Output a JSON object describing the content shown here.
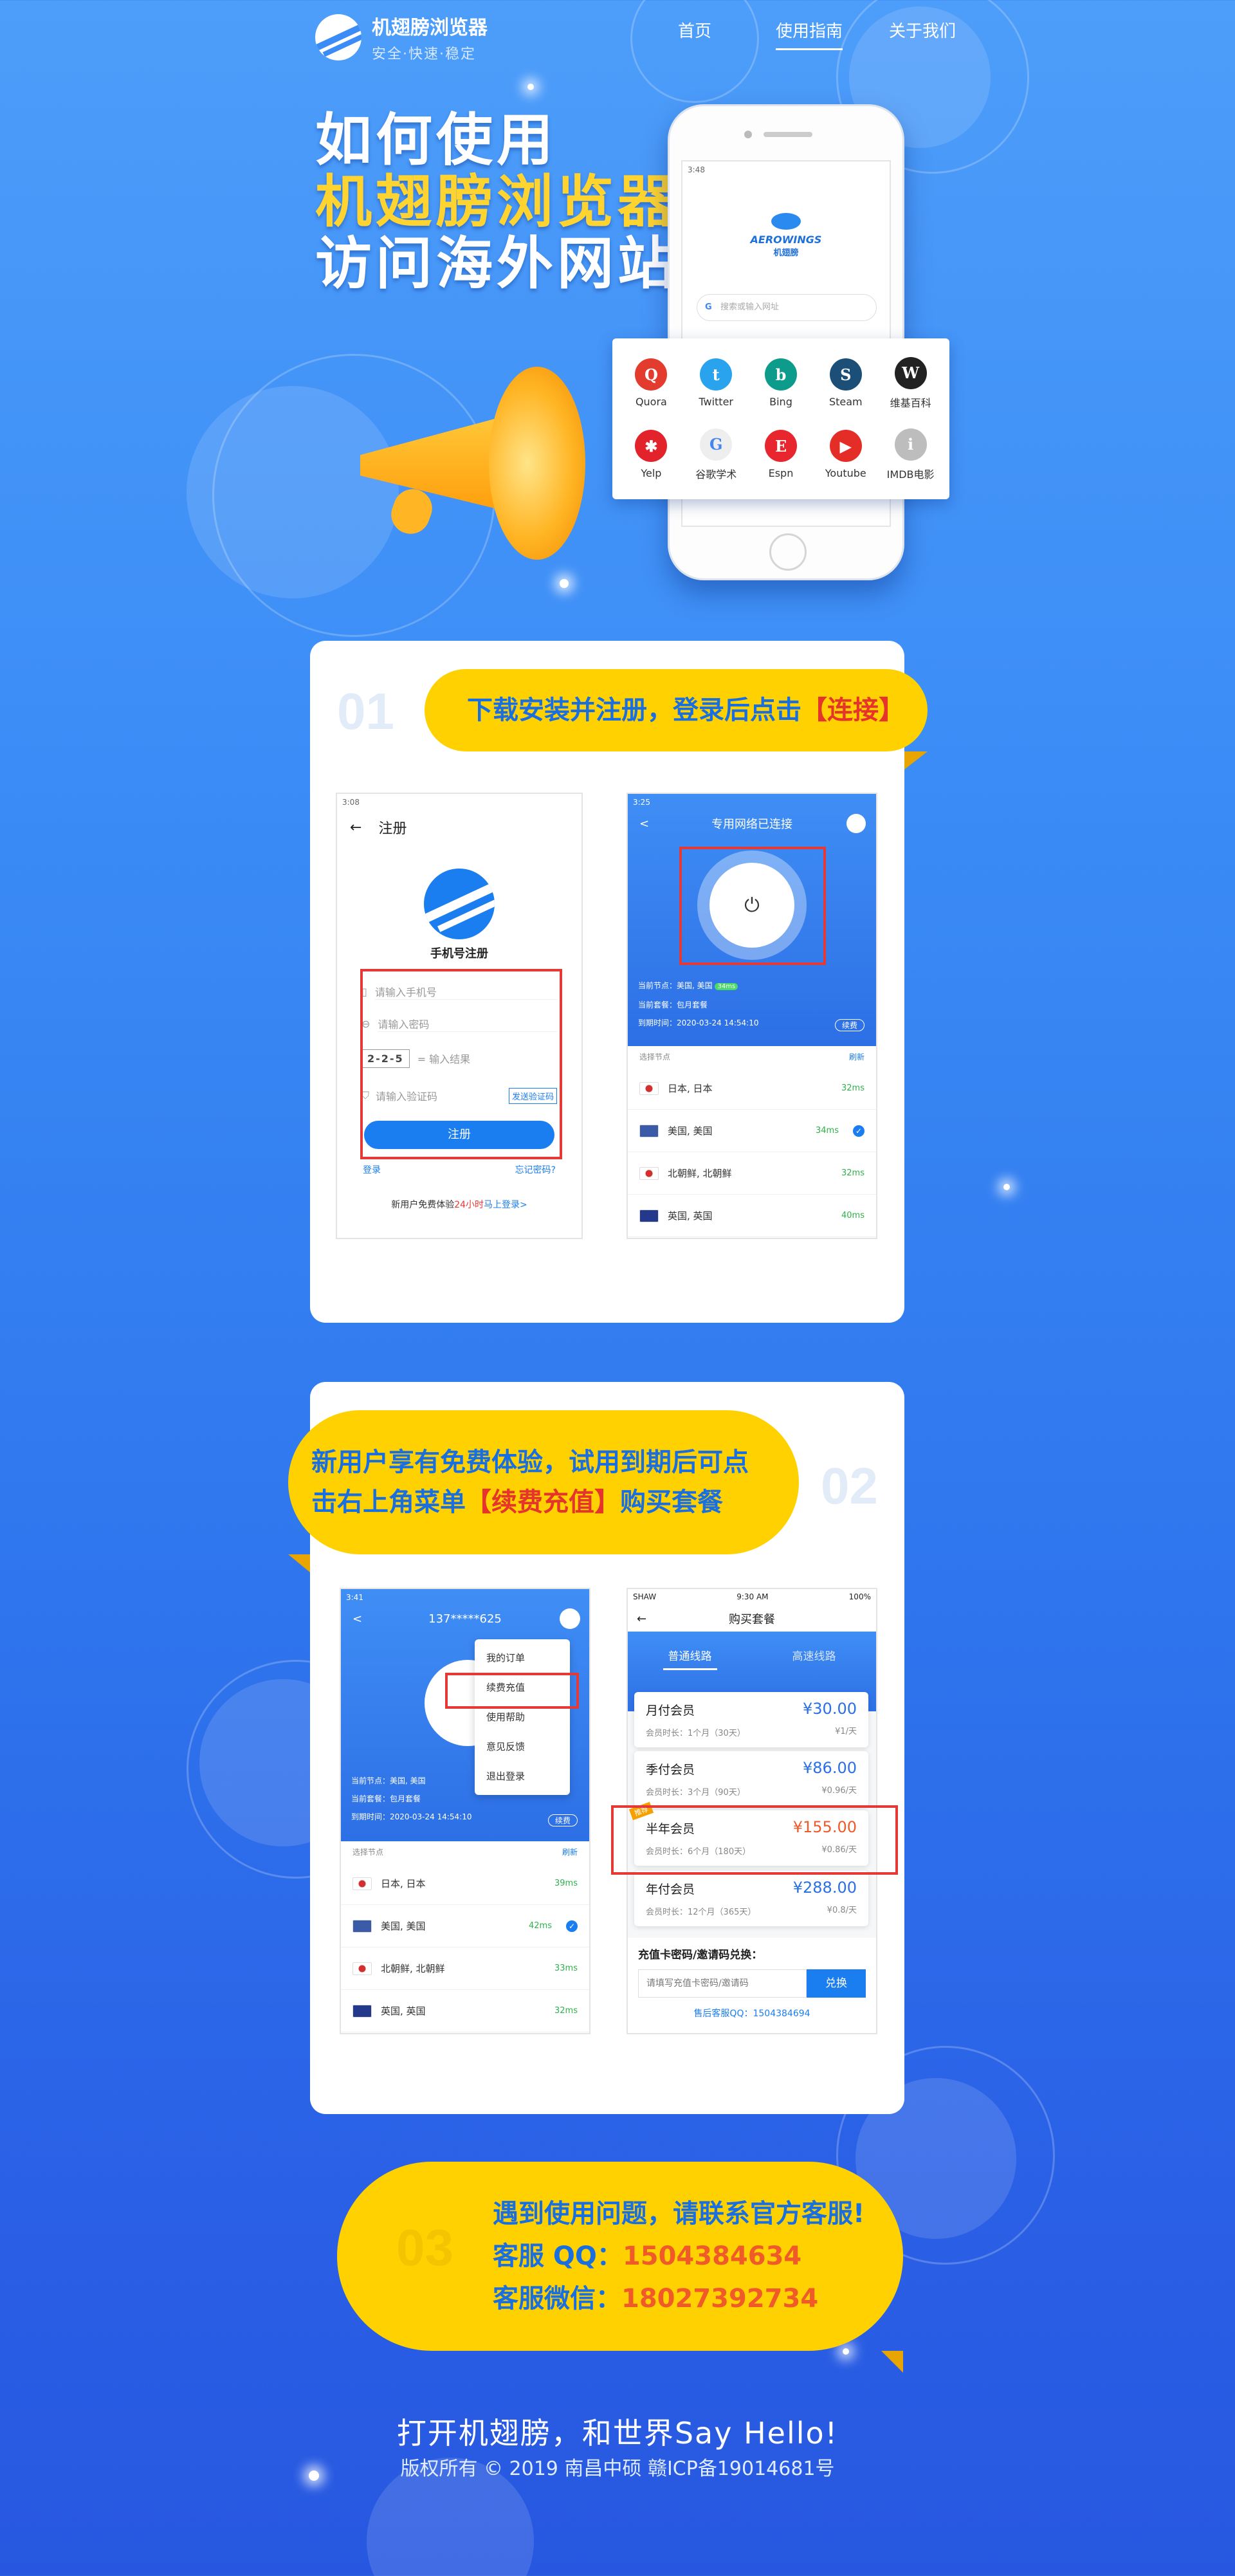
{
  "header": {
    "brand_name": "机翅膀浏览器",
    "brand_slogan": "安全·快速·稳定",
    "nav": [
      "首页",
      "使用指南",
      "关于我们"
    ],
    "active_nav": "使用指南"
  },
  "hero": {
    "line1": "如何使用",
    "line2": "机翅膀浏览器",
    "line3": "访问海外网站"
  },
  "phone_mock": {
    "status_time": "3:48",
    "logo_en": "AEROWINGS",
    "logo_cn": "机翅膀",
    "search_placeholder": "搜索或输入网址"
  },
  "sites": [
    {
      "label": "Quora",
      "glyph": "Q",
      "color": "#e33b2e"
    },
    {
      "label": "Twitter",
      "glyph": "t",
      "color": "#2aa3ef"
    },
    {
      "label": "Bing",
      "glyph": "b",
      "color": "#0d9b8b"
    },
    {
      "label": "Steam",
      "glyph": "S",
      "color": "#1b4f78"
    },
    {
      "label": "维基百科",
      "glyph": "W",
      "color": "#222222"
    },
    {
      "label": "Yelp",
      "glyph": "✱",
      "color": "#e3232b"
    },
    {
      "label": "谷歌学术",
      "glyph": "G",
      "color": "#eeeeee"
    },
    {
      "label": "Espn",
      "glyph": "E",
      "color": "#e8262e"
    },
    {
      "label": "Youtube",
      "glyph": "▶",
      "color": "#e52d27"
    },
    {
      "label": "IMDB电影",
      "glyph": "i",
      "color": "#bdbdbd"
    }
  ],
  "step1": {
    "num": "01",
    "title_pre": "下载安装并注册，登录后点击",
    "title_hl": "【连接】",
    "register": {
      "status_time": "3:08",
      "back": "←",
      "title": "注册",
      "subtitle": "手机号注册",
      "phone_ph": "请输入手机号",
      "password_ph": "请输入密码",
      "captcha_img": "2-2-5",
      "captcha_ph": "= 输入结果",
      "code_ph": "请输入验证码",
      "send_code": "发送验证码",
      "submit": "注册",
      "login": "登录",
      "forgot": "忘记密码?",
      "promo_pre": "新用户免费体验",
      "promo_hl": "24小时",
      "promo_link": "马上登录>"
    },
    "connect": {
      "status_time": "3:25",
      "title": "专用网络已连接",
      "node_label": "当前节点：",
      "node_value": "美国, 美国",
      "node_ms": "34ms",
      "pkg_label": "当前套餐：",
      "pkg_value": "包月套餐",
      "expire_label": "到期时间：",
      "expire_value": "2020-03-24 14:54:10",
      "renew": "续费",
      "list_title": "选择节点",
      "refresh": "刷新",
      "nodes": [
        {
          "name": "日本, 日本",
          "ms": "32ms",
          "color": "#ffffff"
        },
        {
          "name": "美国, 美国",
          "ms": "34ms",
          "color": "#3b5ba9"
        },
        {
          "name": "北朝鲜, 北朝鲜",
          "ms": "32ms",
          "color": "#ffffff"
        },
        {
          "name": "英国, 英国",
          "ms": "40ms",
          "color": "#233a8c"
        }
      ]
    }
  },
  "step2": {
    "num": "02",
    "line1": "新用户享有免费体验，试用到期后可点",
    "line2_pre": "击右上角菜单",
    "line2_hl": "【续费充值】",
    "line2_post": "购买套餐",
    "menu_screen": {
      "status_time": "3:41",
      "phone": "137*****625",
      "menu": [
        "我的订单",
        "续费充值",
        "使用帮助",
        "意见反馈",
        "退出登录"
      ],
      "node_label": "当前节点：",
      "node_value": "美国, 美国",
      "pkg_label": "当前套餐：",
      "pkg_value": "包月套餐",
      "expire_label": "到期时间：",
      "expire_value": "2020-03-24 14:54:10",
      "renew": "续费",
      "list_title": "选择节点",
      "refresh": "刷新",
      "nodes": [
        {
          "name": "日本, 日本",
          "ms": "39ms",
          "color": "#ffffff"
        },
        {
          "name": "美国, 美国",
          "ms": "42ms",
          "color": "#3b5ba9"
        },
        {
          "name": "北朝鲜, 北朝鲜",
          "ms": "33ms",
          "color": "#ffffff"
        },
        {
          "name": "英国, 英国",
          "ms": "32ms",
          "color": "#233a8c"
        }
      ]
    },
    "purchase": {
      "carrier": "SHAW",
      "time": "9:30 AM",
      "battery": "100%",
      "title": "购买套餐",
      "tab1": "普通线路",
      "tab2": "高速线路",
      "badge": "推荐",
      "packages": [
        {
          "name": "月付会员",
          "duration": "会员时长：1个月（30天）",
          "price": "¥30.00",
          "per_day": "¥1/天"
        },
        {
          "name": "季付会员",
          "duration": "会员时长：3个月（90天）",
          "price": "¥86.00",
          "per_day": "¥0.96/天"
        },
        {
          "name": "半年会员",
          "duration": "会员时长：6个月（180天）",
          "price": "¥155.00",
          "per_day": "¥0.86/天"
        },
        {
          "name": "年付会员",
          "duration": "会员时长：12个月（365天）",
          "price": "¥288.00",
          "per_day": "¥0.8/天"
        }
      ],
      "redeem_title": "充值卡密码/邀请码兑换：",
      "redeem_ph": "请填写充值卡密码/邀请码",
      "redeem_btn": "兑换",
      "service_qq": "售后客服QQ：1504384694"
    }
  },
  "step3": {
    "num": "03",
    "line1": "遇到使用问题，请联系官方客服!",
    "qq_label": "客服 QQ：",
    "qq": "1504384634",
    "wx_label": "客服微信：",
    "wx": "18027392734"
  },
  "footer": {
    "slogan": "打开机翅膀，和世界Say Hello!",
    "copyright": "版权所有 © 2019 南昌中硕 赣ICP备19014681号"
  },
  "colors": {
    "accent_yellow": "#ffd100",
    "accent_blue": "#1a6fe0",
    "highlight_red": "#e53935"
  }
}
